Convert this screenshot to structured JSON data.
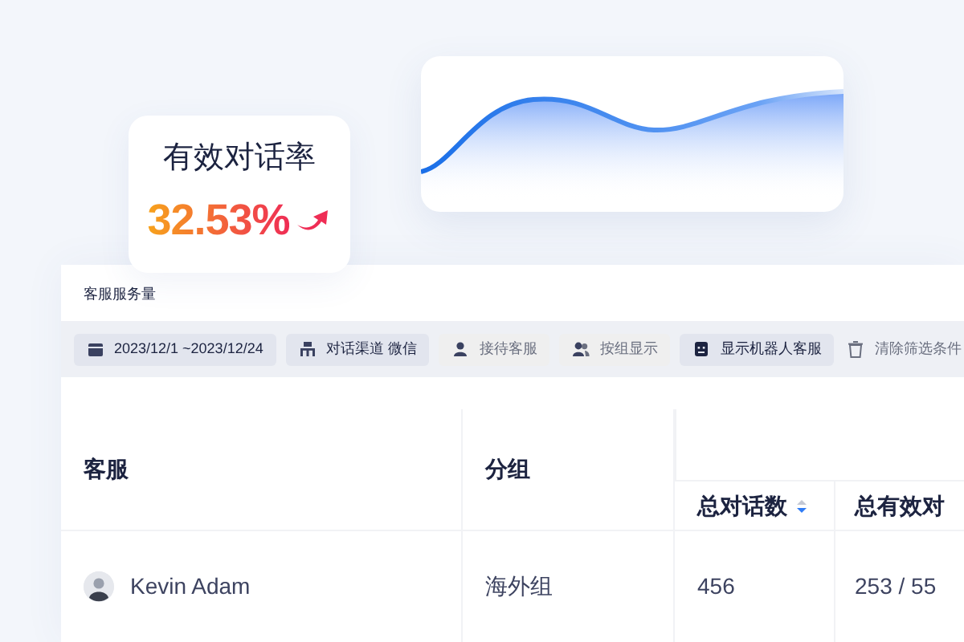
{
  "stat_card": {
    "label": "有效对话率",
    "value": "32.53%",
    "rising": true
  },
  "panel": {
    "title": "客服服务量",
    "filters": [
      {
        "kind": "date",
        "label": "2023/12/1 ~2023/12/24"
      },
      {
        "kind": "select",
        "label": "对话渠道",
        "value": "微信"
      },
      {
        "kind": "person",
        "label": "接待客服"
      },
      {
        "kind": "group",
        "label": "按组显示"
      },
      {
        "kind": "robot",
        "label": "显示机器人客服"
      },
      {
        "kind": "clear",
        "label": "清除筛选条件"
      }
    ],
    "table": {
      "columns": [
        {
          "label": "客服",
          "sorted": false
        },
        {
          "label": "分组",
          "sorted": false
        },
        {
          "label": "总对话数",
          "sorted": true
        },
        {
          "label": "总有效对",
          "sorted": false
        }
      ],
      "rows": [
        {
          "cells": [
            "Kevin Adam",
            "海外组",
            "456",
            "253 / 55"
          ]
        }
      ]
    }
  }
}
